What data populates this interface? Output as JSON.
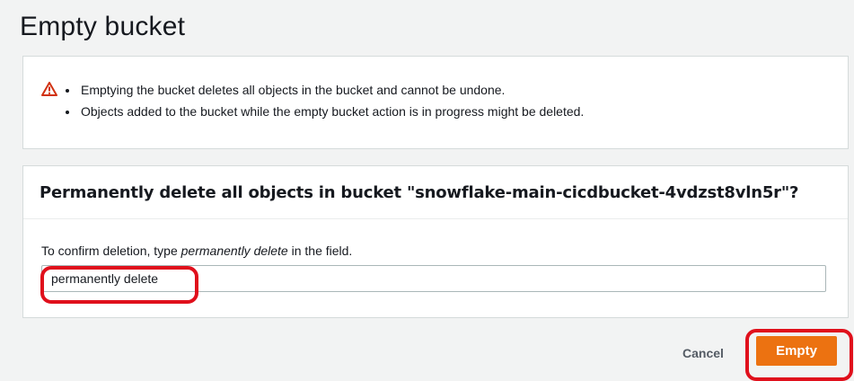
{
  "page": {
    "title": "Empty bucket"
  },
  "warning": {
    "icon": "warning-triangle-icon",
    "icon_color": "#d13212",
    "items": [
      "Emptying the bucket deletes all objects in the bucket and cannot be undone.",
      "Objects added to the bucket while the empty bucket action is in progress might be deleted."
    ]
  },
  "confirm": {
    "heading": "Permanently delete all objects in bucket \"snowflake-main-cicdbucket-4vdzst8vln5r\"?",
    "instruction_prefix": "To confirm deletion, type ",
    "instruction_phrase": "permanently delete",
    "instruction_suffix": " in the field.",
    "input_value": "permanently delete"
  },
  "actions": {
    "cancel_label": "Cancel",
    "empty_label": "Empty",
    "primary_color": "#ec7211"
  }
}
